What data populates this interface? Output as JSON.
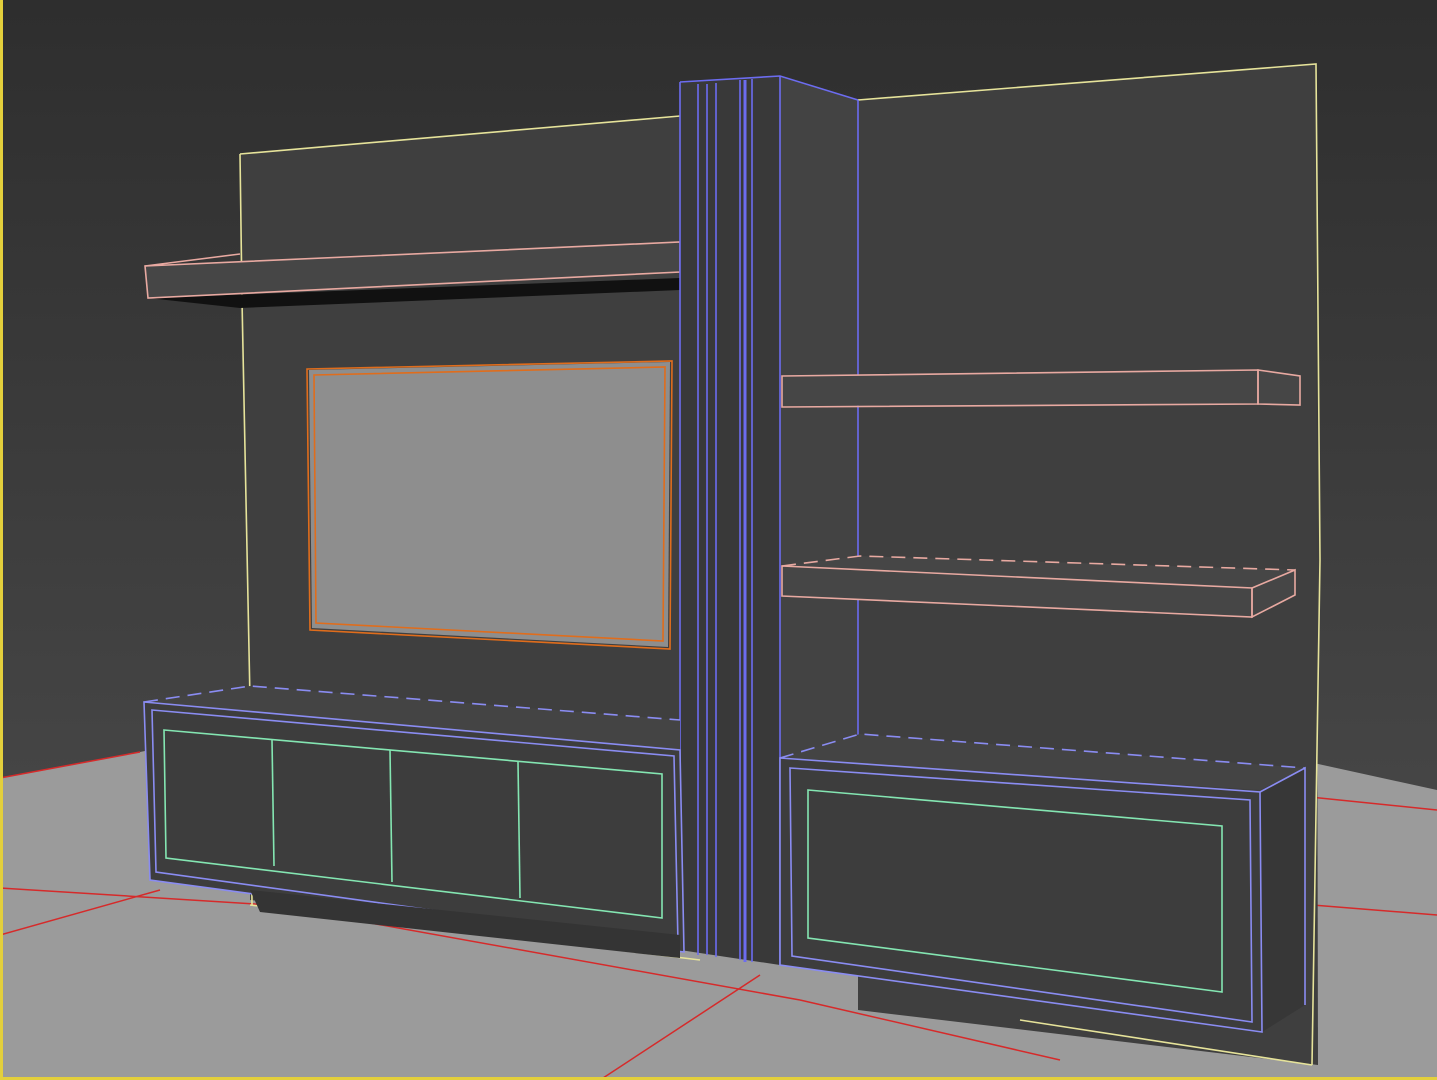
{
  "viewport": {
    "active_border_color": "#e3cf3c",
    "background_top": "#2e2e2e",
    "background_bottom": "#4e4e4e",
    "ground_color": "#9b9b9b",
    "grid_line_color": "#d62a2a"
  },
  "scene_objects": [
    {
      "name": "back-wall-panel",
      "wire_color": "#e6e39a",
      "face_color": "#3f3f3f"
    },
    {
      "name": "left-floating-shelf",
      "wire_color": "#e8a9a1",
      "face_color": "#464646"
    },
    {
      "name": "tv-screen",
      "wire_color": "#e06d1c",
      "face_color": "#8e8e8e"
    },
    {
      "name": "center-column",
      "wire_color": "#6c6cf0",
      "face_color": "#434343"
    },
    {
      "name": "right-upper-shelf",
      "wire_color": "#e8a9a1",
      "face_color": "#464646"
    },
    {
      "name": "right-lower-shelf",
      "wire_color": "#e8a9a1",
      "face_color": "#464646"
    },
    {
      "name": "left-base-cabinet",
      "wire_color": "#8a8cf2",
      "face_color": "#3d3d3d"
    },
    {
      "name": "left-cabinet-doors",
      "wire_color": "#84e6b2",
      "face_color": "#444444"
    },
    {
      "name": "right-base-cabinet",
      "wire_color": "#8a8cf2",
      "face_color": "#3d3d3d"
    },
    {
      "name": "right-cabinet-door",
      "wire_color": "#84e6b2",
      "face_color": "#444444"
    }
  ]
}
